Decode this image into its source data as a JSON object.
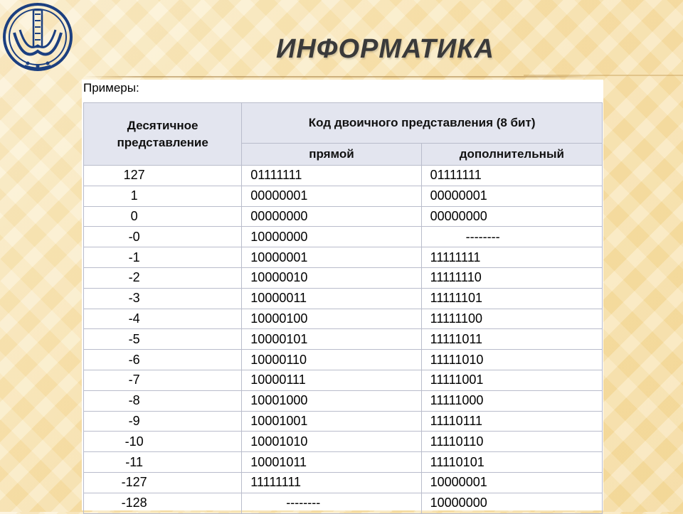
{
  "header": {
    "title": "ИНФОРМАТИКА",
    "logo_icon": "university-emblem-icon"
  },
  "content": {
    "caption": "Примеры:",
    "table": {
      "col_decimal": "Десятичное представление",
      "col_binary_group": "Код двоичного представления (8 бит)",
      "col_direct": "прямой",
      "col_additional": "дополнительный",
      "rows": [
        {
          "decimal": "127",
          "direct": "01111111",
          "additional": "01111111"
        },
        {
          "decimal": "1",
          "direct": "00000001",
          "additional": "00000001"
        },
        {
          "decimal": "0",
          "direct": "00000000",
          "additional": "00000000"
        },
        {
          "decimal": "-0",
          "direct": "10000000",
          "additional": "--------"
        },
        {
          "decimal": "-1",
          "direct": "10000001",
          "additional": "11111111"
        },
        {
          "decimal": "-2",
          "direct": "10000010",
          "additional": "11111110"
        },
        {
          "decimal": "-3",
          "direct": "10000011",
          "additional": "11111101"
        },
        {
          "decimal": "-4",
          "direct": "10000100",
          "additional": "11111100"
        },
        {
          "decimal": "-5",
          "direct": "10000101",
          "additional": "11111011"
        },
        {
          "decimal": "-6",
          "direct": "10000110",
          "additional": "11111010"
        },
        {
          "decimal": "-7",
          "direct": "10000111",
          "additional": "11111001"
        },
        {
          "decimal": "-8",
          "direct": "10001000",
          "additional": "11111000"
        },
        {
          "decimal": "-9",
          "direct": "10001001",
          "additional": "11110111"
        },
        {
          "decimal": "-10",
          "direct": "10001010",
          "additional": "11110110"
        },
        {
          "decimal": "-11",
          "direct": "10001011",
          "additional": "11110101"
        },
        {
          "decimal": "-127",
          "direct": "11111111",
          "additional": "10000001"
        },
        {
          "decimal": "-128",
          "direct": "--------",
          "additional": "10000000"
        }
      ]
    }
  }
}
